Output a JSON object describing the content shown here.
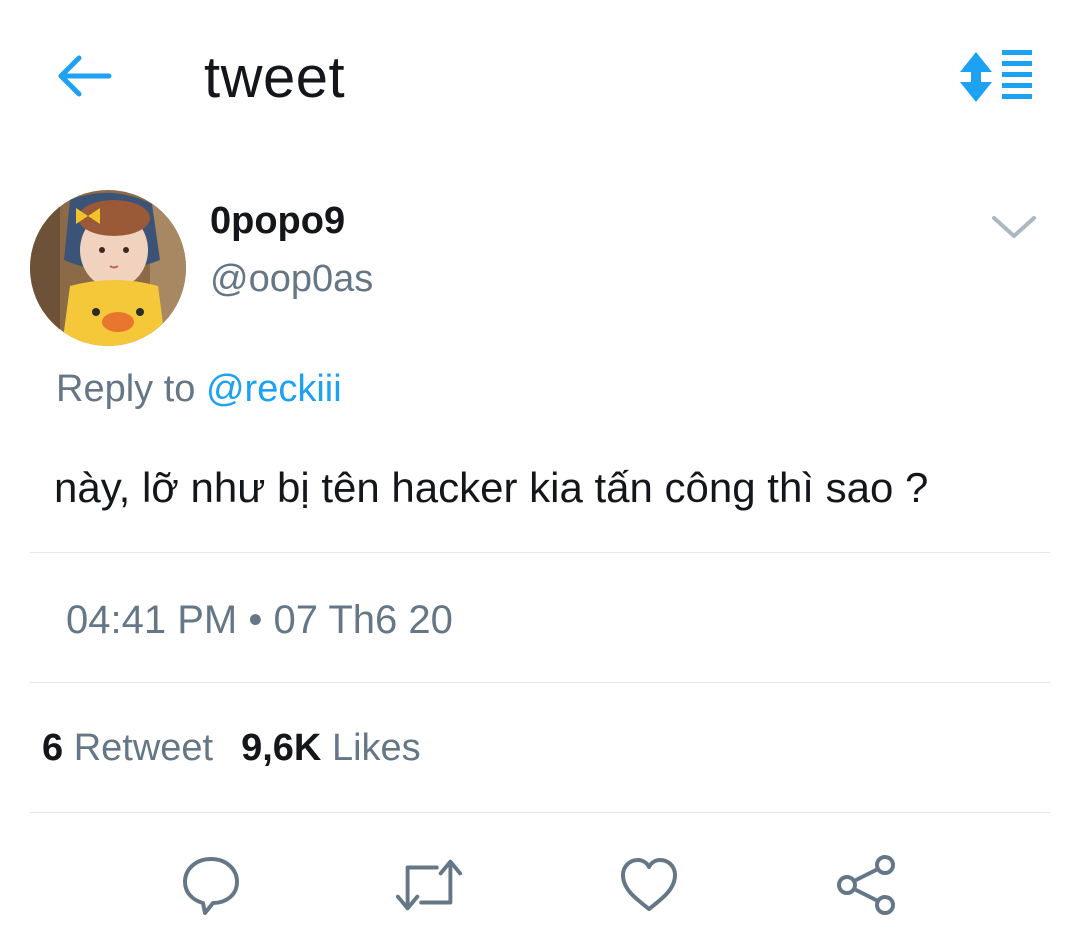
{
  "header": {
    "title": "tweet",
    "back_icon": "arrow-left-icon",
    "sort_icon": "sort-list-icon",
    "accent_color": "#1da1f2"
  },
  "tweet": {
    "author": {
      "display_name": "0popo9",
      "handle": "@oop0as",
      "avatar_icon": "avatar-image"
    },
    "reply": {
      "prefix": "Reply to ",
      "mention": "@reckiii"
    },
    "text": "này, lỡ như bị tên hacker kia tấn công thì sao ?",
    "timestamp": {
      "time": "04:41 PM",
      "separator": "•",
      "date": "07 Th6 20"
    },
    "stats": {
      "retweets_count": "6",
      "retweets_label": "Retweet",
      "likes_count": "9,6K",
      "likes_label": "Likes"
    }
  },
  "actions": [
    {
      "icon": "reply-icon"
    },
    {
      "icon": "retweet-icon"
    },
    {
      "icon": "like-icon"
    },
    {
      "icon": "share-icon"
    }
  ],
  "colors": {
    "text_primary": "#14171a",
    "text_secondary": "#657786",
    "link": "#1da1f2",
    "divider": "#e1e8ed"
  }
}
